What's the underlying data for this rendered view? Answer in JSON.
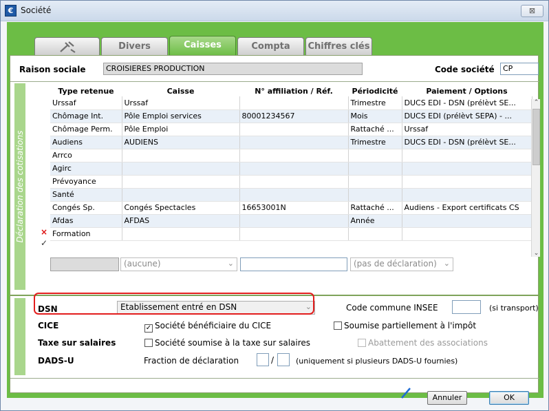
{
  "window": {
    "title": "Société",
    "app_icon": "€",
    "close_glyph": "⊠"
  },
  "tabs": [
    {
      "label": "",
      "icon": "tools-icon"
    },
    {
      "label": "Divers"
    },
    {
      "label": "Caisses",
      "active": true
    },
    {
      "label": "Compta"
    },
    {
      "label": "Chiffres clés"
    }
  ],
  "header": {
    "raison_sociale_label": "Raison sociale",
    "raison_sociale_value": "CROISIERES PRODUCTION",
    "code_societe_label": "Code société",
    "code_societe_value": "CP"
  },
  "declaration": {
    "side_label": "Déclaration des cotisations",
    "columns": [
      "Type retenue",
      "Caisse",
      "N° affiliation / Réf.",
      "Périodicité",
      "Paiement / Options"
    ],
    "rows": [
      {
        "type": "Urssaf",
        "caisse": "Urssaf",
        "affiliation": "",
        "periodicite": "Trimestre",
        "paiement": "DUCS EDI - DSN (prélèvt SE..."
      },
      {
        "type": "Chômage Int.",
        "caisse": "Pôle Emploi services",
        "affiliation": "80001234567",
        "periodicite": "Mois",
        "paiement": "DUCS EDI (prélèvt SEPA) - ..."
      },
      {
        "type": "Chômage Perm.",
        "caisse": "Pôle Emploi",
        "affiliation": "",
        "periodicite": "Rattaché ...",
        "paiement": "Urssaf"
      },
      {
        "type": "Audiens",
        "caisse": "AUDIENS",
        "affiliation": "",
        "periodicite": "Trimestre",
        "paiement": "DUCS EDI - DSN (prélèvt SE..."
      },
      {
        "type": "Arrco",
        "caisse": "",
        "affiliation": "",
        "periodicite": "",
        "paiement": ""
      },
      {
        "type": "Agirc",
        "caisse": "",
        "affiliation": "",
        "periodicite": "",
        "paiement": ""
      },
      {
        "type": "Prévoyance",
        "caisse": "",
        "affiliation": "",
        "periodicite": "",
        "paiement": ""
      },
      {
        "type": "Santé",
        "caisse": "",
        "affiliation": "",
        "periodicite": "",
        "paiement": ""
      },
      {
        "type": "Congés Sp.",
        "caisse": "Congés Spectacles",
        "affiliation": "16653001N",
        "periodicite": "Rattaché ...",
        "paiement": "Audiens - Export certificats CS"
      },
      {
        "type": "Afdas",
        "caisse": "AFDAS",
        "affiliation": "",
        "periodicite": "Année",
        "paiement": ""
      },
      {
        "type": "Formation",
        "caisse": "",
        "affiliation": "",
        "periodicite": "",
        "paiement": ""
      }
    ],
    "row_markers": {
      "delete": "×",
      "check": "✓"
    },
    "scroll_up": "⌃",
    "scroll_down": "⌄",
    "caisse_select": "(aucune)",
    "affiliation_input": "",
    "periodicite_select": "(pas de déclaration)"
  },
  "dsn": {
    "label": "DSN",
    "value": "Etablissement entré en DSN",
    "code_commune_label": "Code commune INSEE",
    "code_commune_value": "",
    "si_transport": "(si transport)"
  },
  "cice": {
    "label": "CICE",
    "beneficiaire_label": "Société bénéficiaire du CICE",
    "beneficiaire_checked": true,
    "check_glyph": "✓",
    "impot_label": "Soumise partiellement à l'impôt",
    "impot_checked": false
  },
  "taxe": {
    "label": "Taxe sur salaires",
    "soumise_label": "Société soumise à la taxe sur salaires",
    "soumise_checked": false,
    "abattement_label": "Abattement des associations",
    "abattement_checked": false
  },
  "dadsu": {
    "label": "DADS-U",
    "fraction_label": "Fraction de déclaration",
    "fraction_a": "",
    "fraction_sep": "/",
    "fraction_b": "",
    "note": "(uniquement si plusieurs DADS-U fournies)"
  },
  "footer": {
    "annuler_label": "Annuler",
    "ok_label": "OK"
  },
  "colors": {
    "accent_green": "#6cbd45",
    "highlight_red": "#e21c1c"
  }
}
